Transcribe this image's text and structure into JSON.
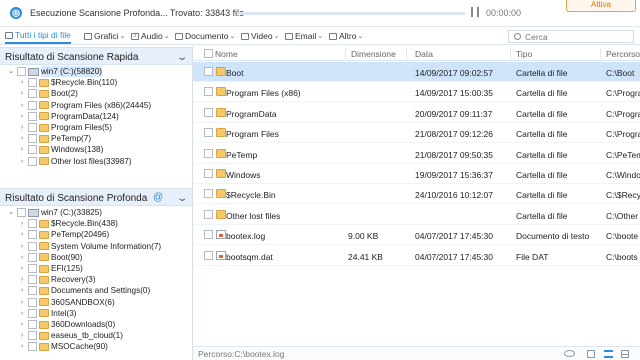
{
  "top": {
    "scan_status": "Esecuzione Scansione Profonda... Trovato: 33843 file",
    "time": "00:00:00",
    "progress": 0.0,
    "action_button": "Attiva"
  },
  "filters": {
    "tabs": [
      {
        "label": "Tutti i tipi di file",
        "icon": "all-files-icon"
      },
      {
        "label": "Grafici",
        "icon": "image-icon"
      },
      {
        "label": "Audio",
        "icon": "audio-icon"
      },
      {
        "label": "Documento",
        "icon": "document-icon"
      },
      {
        "label": "Video",
        "icon": "video-icon"
      },
      {
        "label": "Email",
        "icon": "email-icon"
      },
      {
        "label": "Altro",
        "icon": "other-icon"
      }
    ],
    "search_placeholder": "Cerca"
  },
  "sidebar": {
    "quick": {
      "title": "Risultato di Scansione Rapida",
      "items": [
        {
          "label": "win7 (C:)(58820)",
          "type": "drive"
        },
        {
          "label": "$Recycle.Bin(110)",
          "type": "folder"
        },
        {
          "label": "Boot(2)",
          "type": "folder"
        },
        {
          "label": "Program Files (x86)(24445)",
          "type": "folder"
        },
        {
          "label": "ProgramData(124)",
          "type": "folder"
        },
        {
          "label": "Program Files(5)",
          "type": "folder"
        },
        {
          "label": "PeTemp(7)",
          "type": "folder"
        },
        {
          "label": "Windows(138)",
          "type": "folder"
        },
        {
          "label": "Other lost files(33987)",
          "type": "folder"
        }
      ]
    },
    "deep": {
      "title": "Risultato di Scansione Profonda",
      "items": [
        {
          "label": "win7 (C:)(33825)",
          "type": "drive"
        },
        {
          "label": "$Recycle.Bin(438)",
          "type": "folder"
        },
        {
          "label": "PeTemp(20496)",
          "type": "folder"
        },
        {
          "label": "System Volume Information(7)",
          "type": "folder"
        },
        {
          "label": "Boot(90)",
          "type": "folder"
        },
        {
          "label": "EFI(125)",
          "type": "folder"
        },
        {
          "label": "Recovery(3)",
          "type": "folder"
        },
        {
          "label": "Documents and Settings(0)",
          "type": "folder"
        },
        {
          "label": "360SANDBOX(6)",
          "type": "folder"
        },
        {
          "label": "Intel(3)",
          "type": "folder"
        },
        {
          "label": "360Downloads(0)",
          "type": "folder"
        },
        {
          "label": "easeus_tb_cloud(1)",
          "type": "folder"
        },
        {
          "label": "MSOCache(90)",
          "type": "folder"
        }
      ]
    }
  },
  "table": {
    "columns": [
      "Nome",
      "Dimensione",
      "Data",
      "Tipo",
      "Percorso"
    ],
    "rows": [
      {
        "name": "Boot",
        "size": "",
        "date": "14/09/2017 09:02:57",
        "type": "Cartella di file",
        "path": "C:\\Boot",
        "icon": "folder"
      },
      {
        "name": "Program Files (x86)",
        "size": "",
        "date": "14/09/2017 15:00:35",
        "type": "Cartella di file",
        "path": "C:\\Program",
        "icon": "folder"
      },
      {
        "name": "ProgramData",
        "size": "",
        "date": "20/09/2017 09:11:37",
        "type": "Cartella di file",
        "path": "C:\\Program",
        "icon": "folder"
      },
      {
        "name": "Program Files",
        "size": "",
        "date": "21/08/2017 09:12:26",
        "type": "Cartella di file",
        "path": "C:\\Program",
        "icon": "folder"
      },
      {
        "name": "PeTemp",
        "size": "",
        "date": "21/08/2017 09:50:35",
        "type": "Cartella di file",
        "path": "C:\\PeTem",
        "icon": "folder"
      },
      {
        "name": "Windows",
        "size": "",
        "date": "19/09/2017 15:36:37",
        "type": "Cartella di file",
        "path": "C:\\Windo",
        "icon": "folder"
      },
      {
        "name": "$Recycle.Bin",
        "size": "",
        "date": "24/10/2016 10:12:07",
        "type": "Cartella di file",
        "path": "C:\\$Recy",
        "icon": "folder"
      },
      {
        "name": "Other lost files",
        "size": "",
        "date": "",
        "type": "Cartella di file",
        "path": "C:\\Other",
        "icon": "folder"
      },
      {
        "name": "bootex.log",
        "size": "9.00 KB",
        "date": "04/07/2017 17:45:30",
        "type": "Documento di testo",
        "path": "C:\\boote",
        "icon": "file"
      },
      {
        "name": "bootsqm.dat",
        "size": "24.41 KB",
        "date": "04/07/2017 17:45:30",
        "type": "File DAT",
        "path": "C:\\boots",
        "icon": "file"
      }
    ]
  },
  "status": {
    "path": "Percorso:C:\\bootex.log"
  }
}
